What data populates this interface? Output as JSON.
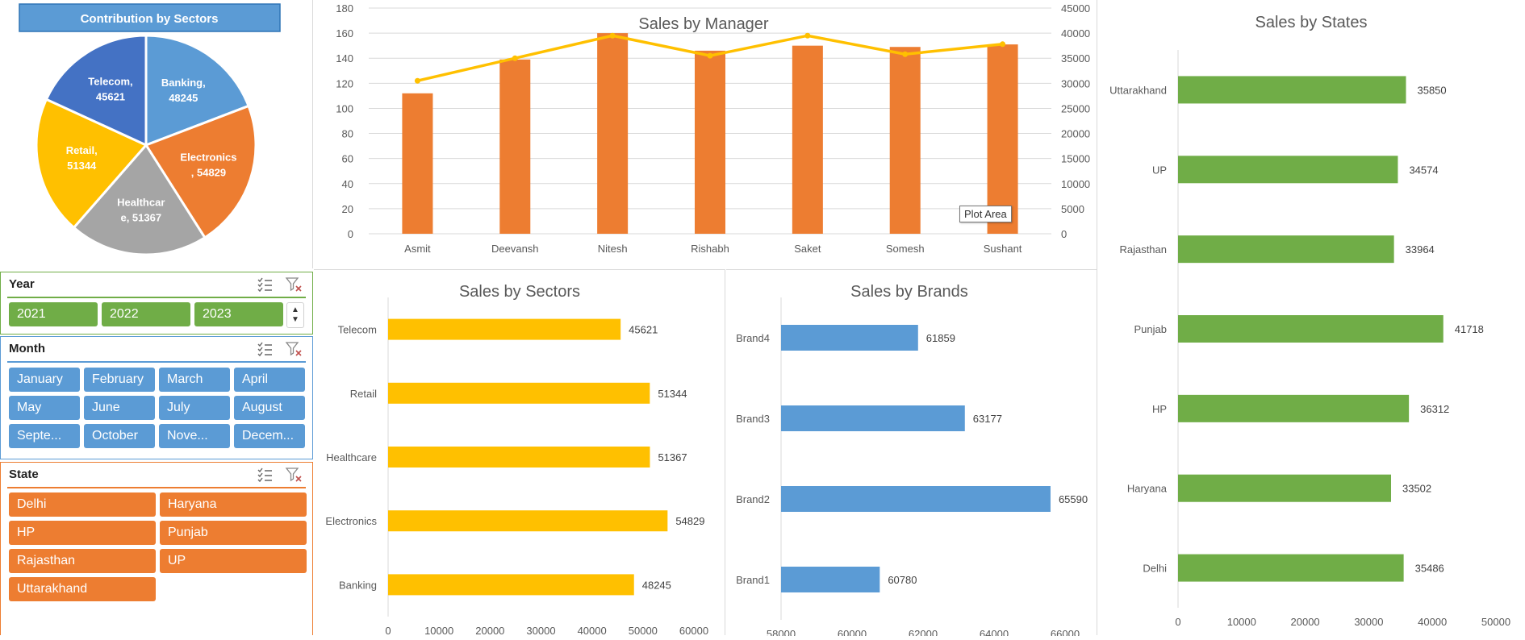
{
  "colors": {
    "pie": [
      "#5b9bd5",
      "#ed7d31",
      "#a5a5a5",
      "#ffc000",
      "#4472c4"
    ],
    "manager_bar": "#ed7d31",
    "manager_line": "#ffc000",
    "sectors_bar": "#ffc000",
    "brands_bar": "#5b9bd5",
    "states_bar": "#70ad47",
    "slicer_year": "#70ad47",
    "slicer_month": "#5b9bd5",
    "slicer_state": "#ed7d31",
    "text": "#595959"
  },
  "pie_title": "Contribution by Sectors",
  "pie_labels": [
    [
      "Banking,",
      "48245"
    ],
    [
      "Electronics",
      ", 54829"
    ],
    [
      "Healthcar",
      "e, 51367"
    ],
    [
      "Retail,",
      "51344"
    ],
    [
      "Telecom,",
      "45621"
    ]
  ],
  "tooltip": "Plot Area",
  "slicers": {
    "year": {
      "title": "Year",
      "items": [
        "2021",
        "2022",
        "2023"
      ],
      "icons": [
        "multi-select-icon",
        "clear-filter-icon"
      ]
    },
    "month": {
      "title": "Month",
      "items": [
        "January",
        "February",
        "March",
        "April",
        "May",
        "June",
        "July",
        "August",
        "Septe...",
        "October",
        "Nove...",
        "Decem..."
      ]
    },
    "state": {
      "title": "State",
      "items": [
        "Delhi",
        "Haryana",
        "HP",
        "Punjab",
        "Rajasthan",
        "UP",
        "Uttarakhand"
      ]
    }
  },
  "chart_data": [
    {
      "id": "pie",
      "type": "pie",
      "title": "Contribution by Sectors",
      "categories": [
        "Banking",
        "Electronics",
        "Healthcare",
        "Retail",
        "Telecom"
      ],
      "values": [
        48245,
        54829,
        51367,
        51344,
        45621
      ],
      "legend": "none",
      "data_labels": true
    },
    {
      "id": "manager",
      "type": "bar",
      "title": "Sales by Manager",
      "categories": [
        "Asmit",
        "Deevansh",
        "Nitesh",
        "Rishabh",
        "Saket",
        "Somesh",
        "Sushant"
      ],
      "series": [
        {
          "type": "bar",
          "axis": "left",
          "values": [
            112,
            139,
            160,
            146,
            150,
            149,
            151
          ]
        },
        {
          "type": "line",
          "axis": "right",
          "values": [
            30500,
            35000,
            39500,
            35500,
            39500,
            35800,
            37800
          ]
        }
      ],
      "ylim": [
        0,
        180
      ],
      "yticks": [
        0,
        20,
        40,
        60,
        80,
        100,
        120,
        140,
        160,
        180
      ],
      "y2lim": [
        0,
        45000
      ],
      "y2ticks": [
        0,
        5000,
        10000,
        15000,
        20000,
        25000,
        30000,
        35000,
        40000,
        45000
      ],
      "grid": true
    },
    {
      "id": "sectors",
      "type": "bar",
      "orientation": "horizontal",
      "title": "Sales by Sectors",
      "categories": [
        "Telecom",
        "Retail",
        "Healthcare",
        "Electronics",
        "Banking"
      ],
      "values": [
        45621,
        51344,
        51367,
        54829,
        48245
      ],
      "xlim": [
        0,
        60000
      ],
      "xticks": [
        0,
        10000,
        20000,
        30000,
        40000,
        50000,
        60000
      ],
      "data_labels": true
    },
    {
      "id": "brands",
      "type": "bar",
      "orientation": "horizontal",
      "title": "Sales by Brands",
      "categories": [
        "Brand4",
        "Brand3",
        "Brand2",
        "Brand1"
      ],
      "values": [
        61859,
        63177,
        65590,
        60780
      ],
      "xlim": [
        58000,
        66000
      ],
      "xticks": [
        58000,
        60000,
        62000,
        64000,
        66000
      ],
      "data_labels": true
    },
    {
      "id": "states",
      "type": "bar",
      "orientation": "horizontal",
      "title": "Sales by States",
      "categories": [
        "Uttarakhand",
        "UP",
        "Rajasthan",
        "Punjab",
        "HP",
        "Haryana",
        "Delhi"
      ],
      "values": [
        35850,
        34574,
        33964,
        41718,
        36312,
        33502,
        35486
      ],
      "xlim": [
        0,
        50000
      ],
      "xticks": [
        0,
        10000,
        20000,
        30000,
        40000,
        50000
      ],
      "data_labels": true
    }
  ]
}
